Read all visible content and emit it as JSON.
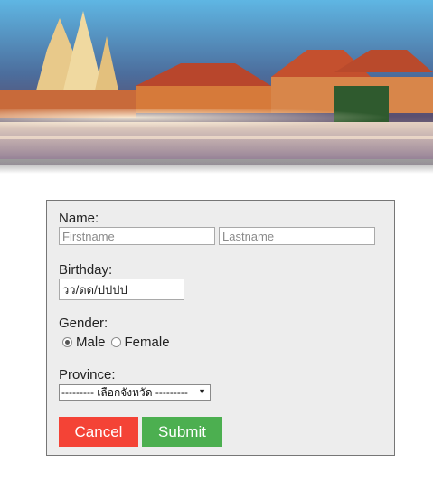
{
  "form": {
    "name_label": "Name:",
    "firstname_placeholder": "Firstname",
    "lastname_placeholder": "Lastname",
    "birthday_label": "Birthday:",
    "birthday_value": "วว/ดด/ปปปป",
    "gender_label": "Gender:",
    "gender_options": [
      "Male",
      "Female"
    ],
    "gender_selected": "Male",
    "province_label": "Province:",
    "province_selected": "--------- เลือกจังหวัด ---------",
    "cancel_label": "Cancel",
    "submit_label": "Submit"
  },
  "colors": {
    "cancel": "#f44336",
    "submit": "#4caf50",
    "panel_bg": "#ededed"
  }
}
